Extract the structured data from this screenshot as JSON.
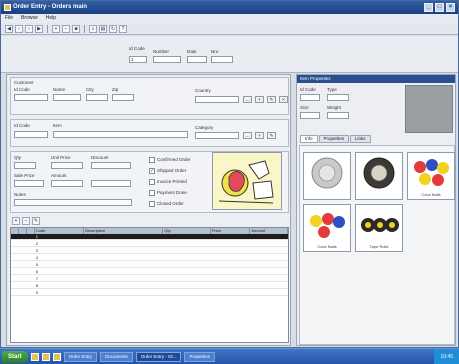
{
  "window": {
    "title": "Order Entry - Orders main"
  },
  "menu": [
    "File",
    "Browse",
    "Help"
  ],
  "top_form": {
    "labels": [
      "Id Code",
      "Number",
      "Date",
      "Nro"
    ],
    "values": [
      "1",
      "",
      "",
      ""
    ]
  },
  "customer_section": {
    "labels": [
      "Customer",
      "Id Code",
      "Name",
      "City",
      "Zip",
      "Country"
    ],
    "values": [
      "",
      "",
      "",
      ""
    ]
  },
  "item_section": {
    "labels": [
      "Id Code",
      "Item",
      "Category"
    ],
    "values": [
      "",
      "",
      ""
    ]
  },
  "options": {
    "labels": [
      "Qty",
      "Unit Price",
      "Discount",
      "Sale Price",
      "Amount",
      "Notes"
    ],
    "checkboxes": [
      "Confirmed Order",
      "Shipped Order",
      "Invoice Printed",
      "Payment Done",
      "Closed Order"
    ]
  },
  "grid": {
    "columns": [
      "",
      "",
      "",
      "Code",
      "Description",
      "Qty",
      "Price",
      "Amount"
    ],
    "rows": [
      [
        "",
        "",
        "",
        "1",
        "",
        "",
        "",
        ""
      ],
      [
        "",
        "",
        "",
        "2",
        "",
        "",
        "",
        ""
      ],
      [
        "",
        "",
        "",
        "3",
        "",
        "",
        "",
        ""
      ],
      [
        "",
        "",
        "",
        "4",
        "",
        "",
        "",
        ""
      ],
      [
        "",
        "",
        "",
        "5",
        "",
        "",
        "",
        ""
      ],
      [
        "",
        "",
        "",
        "6",
        "",
        "",
        "",
        ""
      ],
      [
        "",
        "",
        "",
        "7",
        "",
        "",
        "",
        ""
      ],
      [
        "",
        "",
        "",
        "8",
        "",
        "",
        "",
        ""
      ],
      [
        "",
        "",
        "",
        "9",
        "",
        "",
        "",
        ""
      ]
    ]
  },
  "right_panel": {
    "title": "Item Properties",
    "labels": [
      "Id Code",
      "Size",
      "Weight",
      "Type"
    ],
    "tabs": [
      "Info",
      "Properties",
      "Links"
    ],
    "thumb_captions": [
      "",
      "",
      "Color Balls",
      "Color Balls",
      "Tape Rolls"
    ]
  },
  "taskbar": {
    "start_label": "Start",
    "tasks": [
      "Order Entry",
      "Documents",
      "Order Entry - Or...",
      "Properties"
    ],
    "clock": "10:45"
  },
  "colors": {
    "titlebar": "#1b3f82",
    "taskbar": "#2455a8",
    "selected_row": "#1c1c1c"
  }
}
